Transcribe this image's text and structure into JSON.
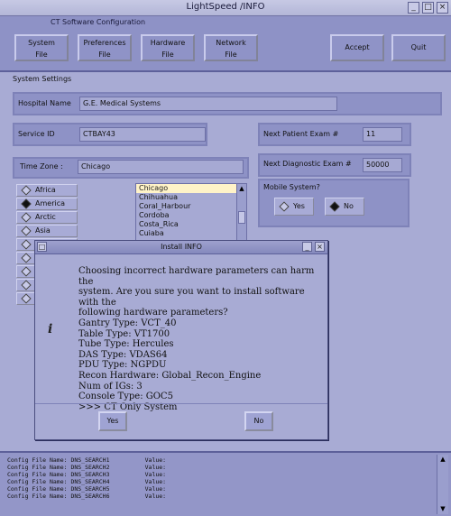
{
  "window": {
    "title": "LightSpeed /INFO",
    "subtitle": "CT Software Configuration"
  },
  "toolbar": [
    {
      "l1": "System",
      "l2": "File"
    },
    {
      "l1": "Preferences",
      "l2": "File"
    },
    {
      "l1": "Hardware",
      "l2": "File"
    },
    {
      "l1": "Network",
      "l2": "File"
    },
    {
      "l1": "Accept",
      "l2": ""
    },
    {
      "l1": "Quit",
      "l2": ""
    }
  ],
  "system_settings": {
    "title": "System Settings",
    "hospital_label": "Hospital Name",
    "hospital_value": "G.E. Medical Systems",
    "service_label": "Service ID",
    "service_value": "CTBAY43",
    "next_patient_label": "Next Patient Exam #",
    "next_patient_value": "11",
    "next_diag_label": "Next Diagnostic Exam #",
    "next_diag_value": "50000",
    "timezone_label": "Time Zone :",
    "timezone_value": "Chicago",
    "regions": [
      "Africa",
      "America",
      "Arctic",
      "Asia"
    ],
    "selected_region": "America",
    "cities": [
      "Chicago",
      "Chihuahua",
      "Coral_Harbour",
      "Cordoba",
      "Costa_Rica",
      "Cuiaba"
    ],
    "selected_city": "Chicago",
    "mobile_label": "Mobile System?",
    "mobile_yes": "Yes",
    "mobile_no": "No",
    "mobile_selected": "No"
  },
  "dialog": {
    "title": "Install INFO",
    "lines": [
      "Choosing incorrect hardware parameters can harm the",
      "system. Are you sure you want to install software with the",
      "following hardware parameters?",
      "Gantry Type: VCT_40",
      "Table Type: VT1700",
      "Tube Type: Hercules",
      "DAS Type: VDAS64",
      "PDU Type: NGPDU",
      "Recon Hardware: Global_Recon_Engine",
      "Num of IGs: 3",
      "Console Type: GOC5",
      ">>>  CT Only System"
    ],
    "yes_label": "Yes",
    "no_label": "No",
    "icon": "info-icon"
  },
  "log": [
    "Config File Name: DNS_SEARCH1          Value:",
    "Config File Name: DNS_SEARCH2          Value:",
    "Config File Name: DNS_SEARCH3          Value:",
    "Config File Name: DNS_SEARCH4          Value:",
    "Config File Name: DNS_SEARCH5          Value:",
    "Config File Name: DNS_SEARCH6          Value:"
  ],
  "colors": {
    "background": "#a8abd4",
    "panel": "#8e92c6",
    "selected_item": "#fff3c8"
  }
}
